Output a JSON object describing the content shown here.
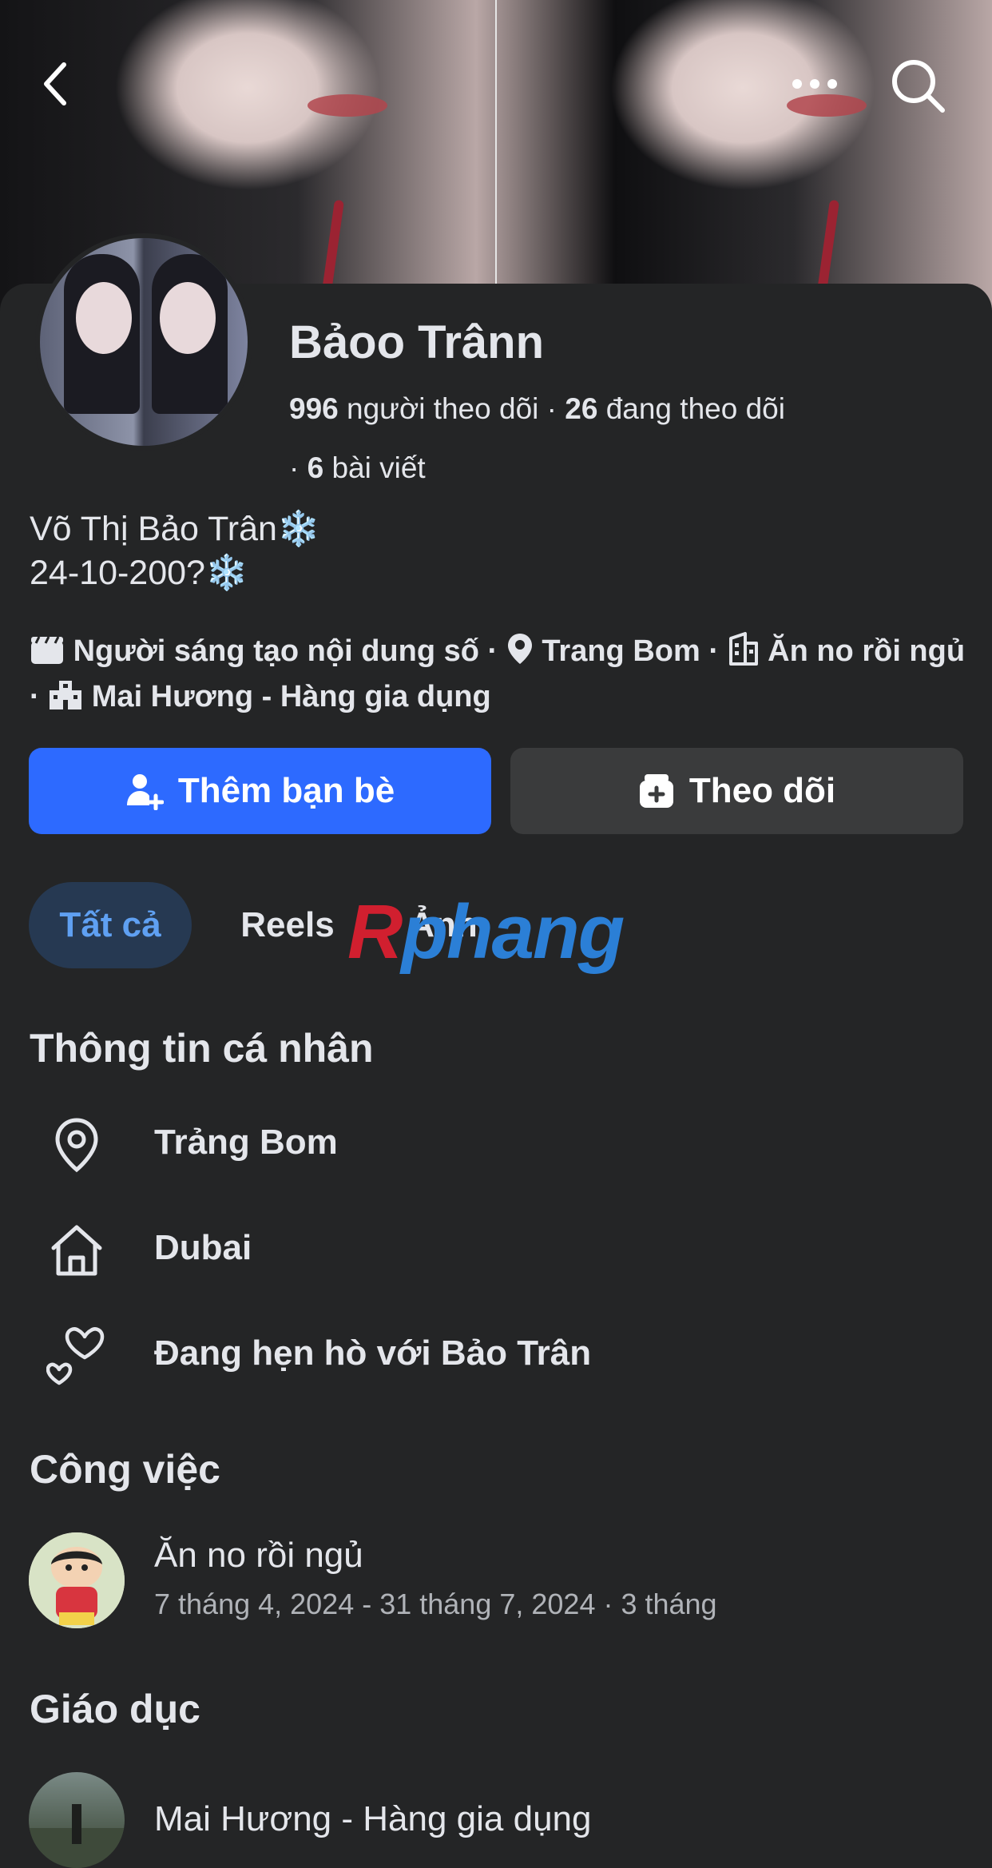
{
  "profile": {
    "name": "Bảoo Trânn",
    "followers_count": "996",
    "followers_label": "người theo dõi",
    "following_count": "26",
    "following_label": "đang theo dõi",
    "posts_count": "6",
    "posts_label": "bài viết",
    "bio_line1": "Võ Thị Bảo Trân❄️",
    "bio_line2": "24-10-200?❄️"
  },
  "details": {
    "category": "Người sáng tạo nội dung số",
    "location": "Trang Bom",
    "workplace": "Ăn no rồi ngủ",
    "school": "Mai Hương - Hàng gia dụng"
  },
  "actions": {
    "add_friend": "Thêm bạn bè",
    "follow": "Theo dõi"
  },
  "tabs": [
    {
      "label": "Tất cả"
    },
    {
      "label": "Reels"
    },
    {
      "label": "Ảnh"
    }
  ],
  "watermark": {
    "prefix": "R",
    "rest": "phang"
  },
  "about": {
    "title": "Thông tin cá nhân",
    "items": [
      {
        "icon": "location-pin-icon",
        "text": "Trảng Bom"
      },
      {
        "icon": "home-icon",
        "text": "Dubai"
      },
      {
        "icon": "hearts-icon",
        "text": "Đang hẹn hò với Bảo Trân"
      }
    ]
  },
  "work": {
    "title": "Công việc",
    "company": "Ăn no rồi ngủ",
    "period": "7 tháng 4, 2024 - 31 tháng 7, 2024 · 3 tháng"
  },
  "education": {
    "title": "Giáo dục",
    "school": "Mai Hương - Hàng gia dụng"
  },
  "colors": {
    "background": "#242526",
    "primary_button": "#2d6aff",
    "secondary_button": "#3a3b3c",
    "active_tab_bg": "#263952",
    "active_tab_text": "#5fa0f2"
  }
}
